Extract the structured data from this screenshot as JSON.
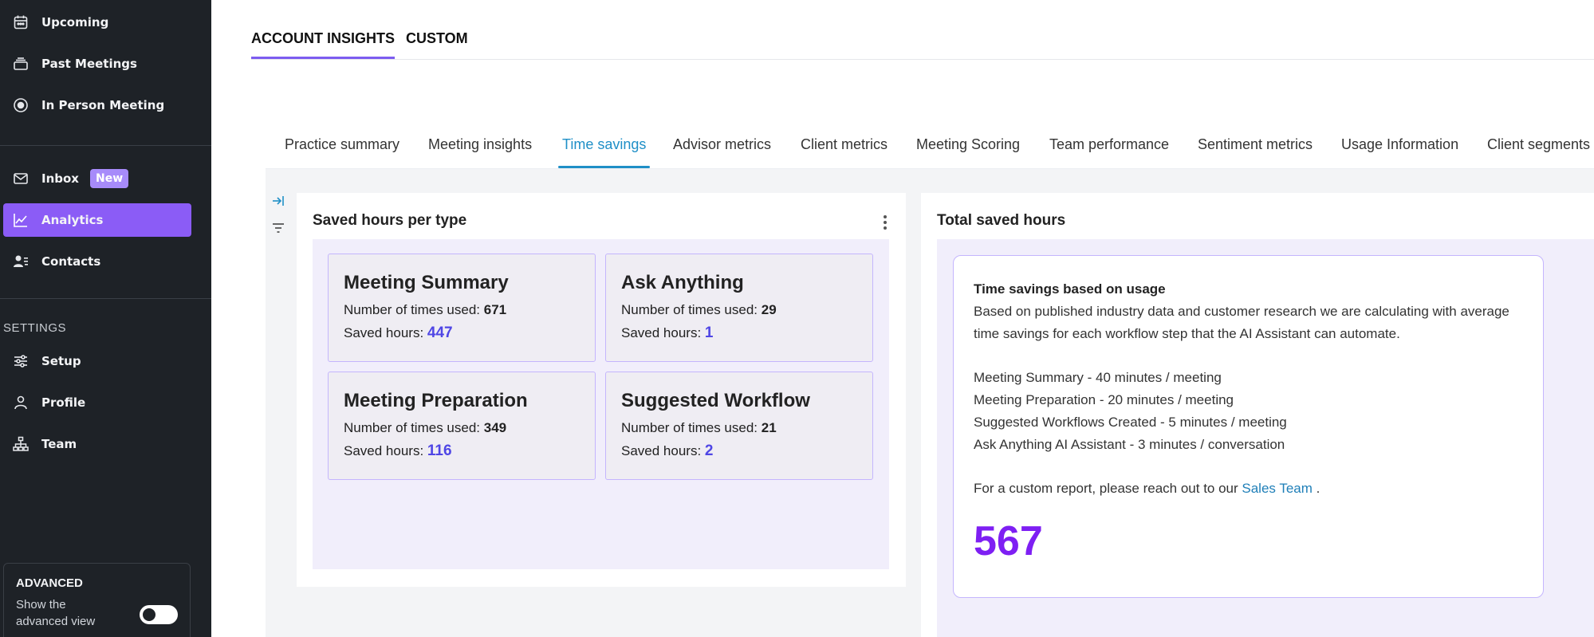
{
  "sidebar": {
    "items": [
      {
        "label": "Upcoming",
        "icon": "calendar-icon"
      },
      {
        "label": "Past Meetings",
        "icon": "stack-icon"
      },
      {
        "label": "In Person Meeting",
        "icon": "record-icon"
      },
      {
        "label": "Inbox",
        "icon": "mail-icon",
        "badge": "New"
      },
      {
        "label": "Analytics",
        "icon": "chart-line-icon"
      },
      {
        "label": "Contacts",
        "icon": "contacts-icon"
      }
    ],
    "settings_label": "SETTINGS",
    "settings_items": [
      {
        "label": "Setup",
        "icon": "sliders-icon"
      },
      {
        "label": "Profile",
        "icon": "person-icon"
      },
      {
        "label": "Team",
        "icon": "org-chart-icon"
      }
    ],
    "advanced": {
      "title": "ADVANCED",
      "description": "Show the advanced view",
      "toggle_on": false
    },
    "colors": {
      "background": "#1e2227",
      "active": "#8b5cf6",
      "badge": "#a78bfa"
    }
  },
  "top_tabs": [
    {
      "label": "ACCOUNT INSIGHTS",
      "active": true
    },
    {
      "label": "CUSTOM",
      "active": false
    }
  ],
  "sub_tabs": [
    {
      "label": "Practice summary"
    },
    {
      "label": "Meeting insights"
    },
    {
      "label": "Time savings",
      "active": true
    },
    {
      "label": "Advisor metrics"
    },
    {
      "label": "Client metrics"
    },
    {
      "label": "Meeting Scoring"
    },
    {
      "label": "Team performance"
    },
    {
      "label": "Sentiment metrics"
    },
    {
      "label": "Usage Information"
    },
    {
      "label": "Client segments"
    }
  ],
  "saved_hours_panel": {
    "title": "Saved hours per type",
    "times_used_label": "Number of times used: ",
    "saved_hours_label": "Saved hours: ",
    "cards": [
      {
        "name": "Meeting Summary",
        "times_used": "671",
        "saved_hours": "447"
      },
      {
        "name": "Ask Anything",
        "times_used": "29",
        "saved_hours": "1"
      },
      {
        "name": "Meeting Preparation",
        "times_used": "349",
        "saved_hours": "116"
      },
      {
        "name": "Suggested Workflow",
        "times_used": "21",
        "saved_hours": "2"
      }
    ]
  },
  "total_panel": {
    "title": "Total saved hours",
    "heading": "Time savings based on usage",
    "description": "Based on published industry data and customer research we are calculating with average time savings for each workflow step that the AI Assistant can automate.",
    "rates": [
      "Meeting Summary - 40 minutes / meeting",
      "Meeting Preparation - 20 minutes / meeting",
      "Suggested Workflows Created - 5 minutes / meeting",
      "Ask Anything AI Assistant - 3 minutes / conversation"
    ],
    "contact_prefix": "For a custom report, please reach out to our ",
    "contact_link": "Sales Team",
    "contact_suffix": " .",
    "total": "567"
  },
  "colors": {
    "accent": "#7c5cf0",
    "active_subtab": "#1f8fc7",
    "value": "#4f46e5",
    "total": "#7e1ff3"
  }
}
